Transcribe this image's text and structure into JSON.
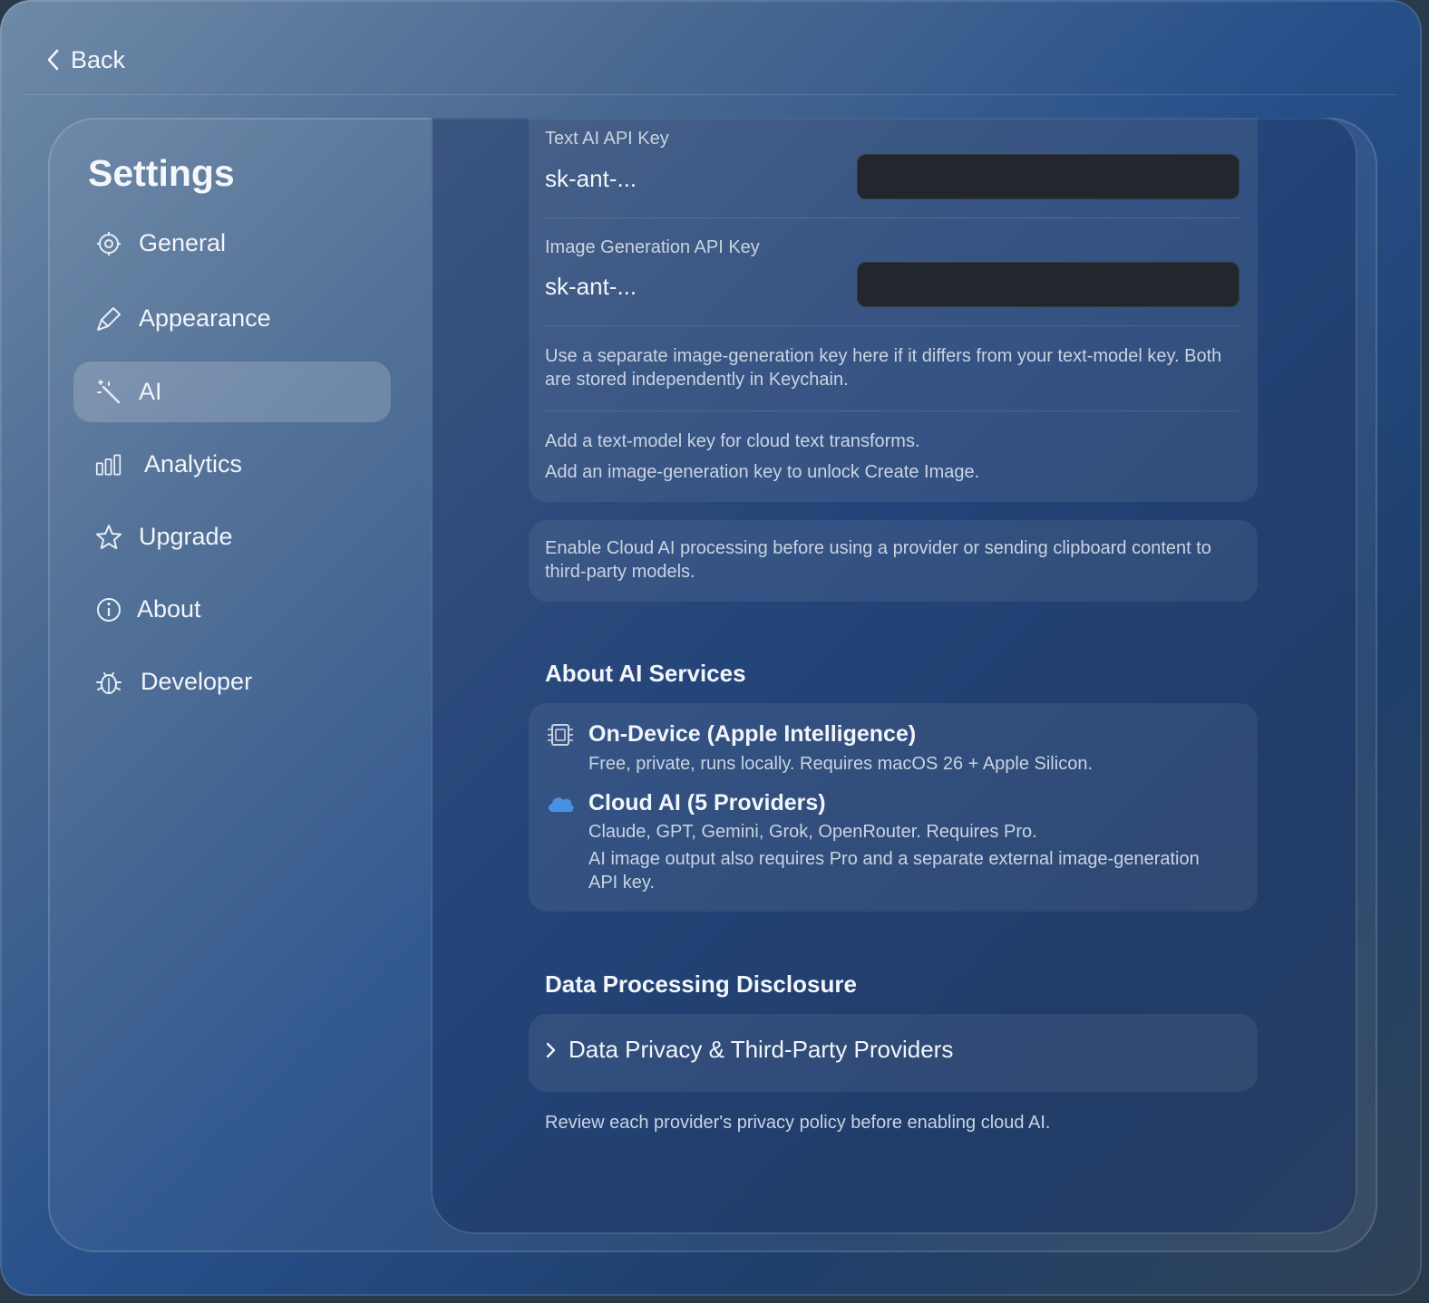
{
  "header": {
    "back_label": "Back"
  },
  "sidebar": {
    "title": "Settings",
    "items": [
      {
        "label": "General",
        "icon": "gear-icon"
      },
      {
        "label": "Appearance",
        "icon": "paintbrush-icon"
      },
      {
        "label": "AI",
        "icon": "magic-wand-icon",
        "active": true
      },
      {
        "label": "Analytics",
        "icon": "bar-chart-icon"
      },
      {
        "label": "Upgrade",
        "icon": "star-icon"
      },
      {
        "label": "About",
        "icon": "info-icon"
      },
      {
        "label": "Developer",
        "icon": "bug-icon"
      }
    ]
  },
  "api_keys": {
    "text_key_label": "Text AI API Key",
    "text_key_value": "sk-ant-...",
    "image_key_label": "Image Generation API Key",
    "image_key_value": "sk-ant-...",
    "separate_key_note": "Use a separate image-generation key here if it differs from your text-model key. Both are stored independently in Keychain.",
    "hint_text": "Add a text-model key for cloud text transforms.",
    "hint_image": "Add an image-generation key to unlock Create Image."
  },
  "cloud_notice": "Enable Cloud AI processing before using a provider or sending clipboard content to third-party models.",
  "about_services": {
    "heading": "About AI Services",
    "on_device_title": "On-Device (Apple Intelligence)",
    "on_device_desc": "Free, private, runs locally. Requires macOS 26 + Apple Silicon.",
    "cloud_title": "Cloud AI (5 Providers)",
    "cloud_desc": "Claude, GPT, Gemini, Grok, OpenRouter. Requires Pro.",
    "cloud_image_note": "AI image output also requires Pro and a separate external image-generation API key."
  },
  "data_processing": {
    "heading": "Data Processing Disclosure",
    "disclosure_label": "Data Privacy & Third-Party Providers",
    "footer_note": "Review each provider's privacy policy before enabling cloud AI."
  },
  "colors": {
    "accent_cloud": "#4a90e2",
    "input_bg": "#22272e"
  }
}
